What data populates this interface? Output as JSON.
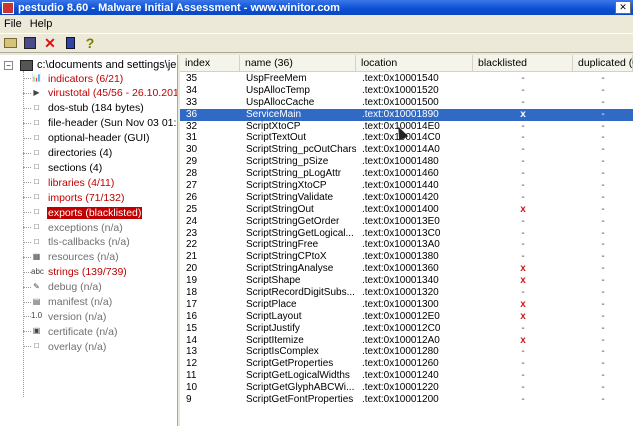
{
  "window": {
    "title": "pestudio 8.60 - Malware Initial Assessment - www.winitor.com",
    "close_glyph": "✕"
  },
  "menu": [
    "File",
    "Help"
  ],
  "toolbar": [
    "open-icon",
    "save-icon",
    "cancel-icon",
    "export-icon",
    "help-icon"
  ],
  "tree": {
    "root": "c:\\documents and settings\\jeuser",
    "expander": "−",
    "items": [
      {
        "label": "indicators (6/21)",
        "icon": "bar-chart-icon",
        "style": "red"
      },
      {
        "label": "virustotal (45/56 - 26.10.201",
        "icon": "play-icon",
        "style": "red"
      },
      {
        "label": "dos-stub (184 bytes)",
        "icon": "box-icon",
        "style": "normal"
      },
      {
        "label": "file-header (Sun Nov 03 01:2",
        "icon": "box-icon",
        "style": "normal"
      },
      {
        "label": "optional-header (GUI)",
        "icon": "box-icon",
        "style": "normal"
      },
      {
        "label": "directories (4)",
        "icon": "box-icon",
        "style": "normal"
      },
      {
        "label": "sections (4)",
        "icon": "box-icon",
        "style": "normal"
      },
      {
        "label": "libraries (4/11)",
        "icon": "box-icon",
        "style": "red"
      },
      {
        "label": "imports (71/132)",
        "icon": "box-icon",
        "style": "red"
      },
      {
        "label": "exports (blacklisted)",
        "icon": "box-icon",
        "style": "selected"
      },
      {
        "label": "exceptions (n/a)",
        "icon": "box-icon",
        "style": "gray"
      },
      {
        "label": "tls-callbacks (n/a)",
        "icon": "box-icon",
        "style": "gray"
      },
      {
        "label": "resources (n/a)",
        "icon": "resources-icon",
        "style": "gray"
      },
      {
        "label": "strings (139/739)",
        "icon": "abc-icon",
        "style": "red"
      },
      {
        "label": "debug (n/a)",
        "icon": "debug-icon",
        "style": "gray"
      },
      {
        "label": "manifest (n/a)",
        "icon": "manifest-icon",
        "style": "gray"
      },
      {
        "label": "version (n/a)",
        "icon": "version-icon",
        "style": "gray"
      },
      {
        "label": "certificate (n/a)",
        "icon": "certificate-icon",
        "style": "gray"
      },
      {
        "label": "overlay (n/a)",
        "icon": "overlay-icon",
        "style": "gray"
      }
    ],
    "icon_glyphs": {
      "bar-chart-icon": "📊",
      "play-icon": "▶",
      "box-icon": "□",
      "resources-icon": "▦",
      "abc-icon": "abc",
      "debug-icon": "✎",
      "manifest-icon": "▤",
      "version-icon": "1.0",
      "certificate-icon": "▣",
      "overlay-icon": "□"
    }
  },
  "table": {
    "columns": [
      "index",
      "name (36)",
      "location",
      "blacklisted",
      "duplicated (0)"
    ],
    "selected_index": 3,
    "rows": [
      [
        "35",
        "UspFreeMem",
        ".text:0x10001540",
        "-",
        "-"
      ],
      [
        "34",
        "UspAllocTemp",
        ".text:0x10001520",
        "-",
        "-"
      ],
      [
        "33",
        "UspAllocCache",
        ".text:0x10001500",
        "-",
        "-"
      ],
      [
        "36",
        "ServiceMain",
        ".text:0x10001890",
        "x",
        "-"
      ],
      [
        "32",
        "ScriptXtoCP",
        ".text:0x100014E0",
        "-",
        "-"
      ],
      [
        "31",
        "ScriptTextOut",
        ".text:0x100014C0",
        "-",
        "-"
      ],
      [
        "30",
        "ScriptString_pcOutChars",
        ".text:0x100014A0",
        "-",
        "-"
      ],
      [
        "29",
        "ScriptString_pSize",
        ".text:0x10001480",
        "-",
        "-"
      ],
      [
        "28",
        "ScriptString_pLogAttr",
        ".text:0x10001460",
        "-",
        "-"
      ],
      [
        "27",
        "ScriptStringXtoCP",
        ".text:0x10001440",
        "-",
        "-"
      ],
      [
        "26",
        "ScriptStringValidate",
        ".text:0x10001420",
        "-",
        "-"
      ],
      [
        "25",
        "ScriptStringOut",
        ".text:0x10001400",
        "x",
        "-"
      ],
      [
        "24",
        "ScriptStringGetOrder",
        ".text:0x100013E0",
        "-",
        "-"
      ],
      [
        "23",
        "ScriptStringGetLogical...",
        ".text:0x100013C0",
        "-",
        "-"
      ],
      [
        "22",
        "ScriptStringFree",
        ".text:0x100013A0",
        "-",
        "-"
      ],
      [
        "21",
        "ScriptStringCPtoX",
        ".text:0x10001380",
        "-",
        "-"
      ],
      [
        "20",
        "ScriptStringAnalyse",
        ".text:0x10001360",
        "x",
        "-"
      ],
      [
        "19",
        "ScriptShape",
        ".text:0x10001340",
        "x",
        "-"
      ],
      [
        "18",
        "ScriptRecordDigitSubs...",
        ".text:0x10001320",
        "-",
        "-"
      ],
      [
        "17",
        "ScriptPlace",
        ".text:0x10001300",
        "x",
        "-"
      ],
      [
        "16",
        "ScriptLayout",
        ".text:0x100012E0",
        "x",
        "-"
      ],
      [
        "15",
        "ScriptJustify",
        ".text:0x100012C0",
        "-",
        "-"
      ],
      [
        "14",
        "ScriptItemize",
        ".text:0x100012A0",
        "x",
        "-"
      ],
      [
        "13",
        "ScriptIsComplex",
        ".text:0x10001280",
        "-",
        "-"
      ],
      [
        "12",
        "ScriptGetProperties",
        ".text:0x10001260",
        "-",
        "-"
      ],
      [
        "11",
        "ScriptGetLogicalWidths",
        ".text:0x10001240",
        "-",
        "-"
      ],
      [
        "10",
        "ScriptGetGlyphABCWi...",
        ".text:0x10001220",
        "-",
        "-"
      ],
      [
        "9",
        "ScriptGetFontProperties",
        ".text:0x10001200",
        "-",
        "-"
      ]
    ]
  },
  "colors": {
    "title_bar": "#0a4fd3",
    "selection": "#316ac5",
    "alert_red": "#c00000"
  }
}
